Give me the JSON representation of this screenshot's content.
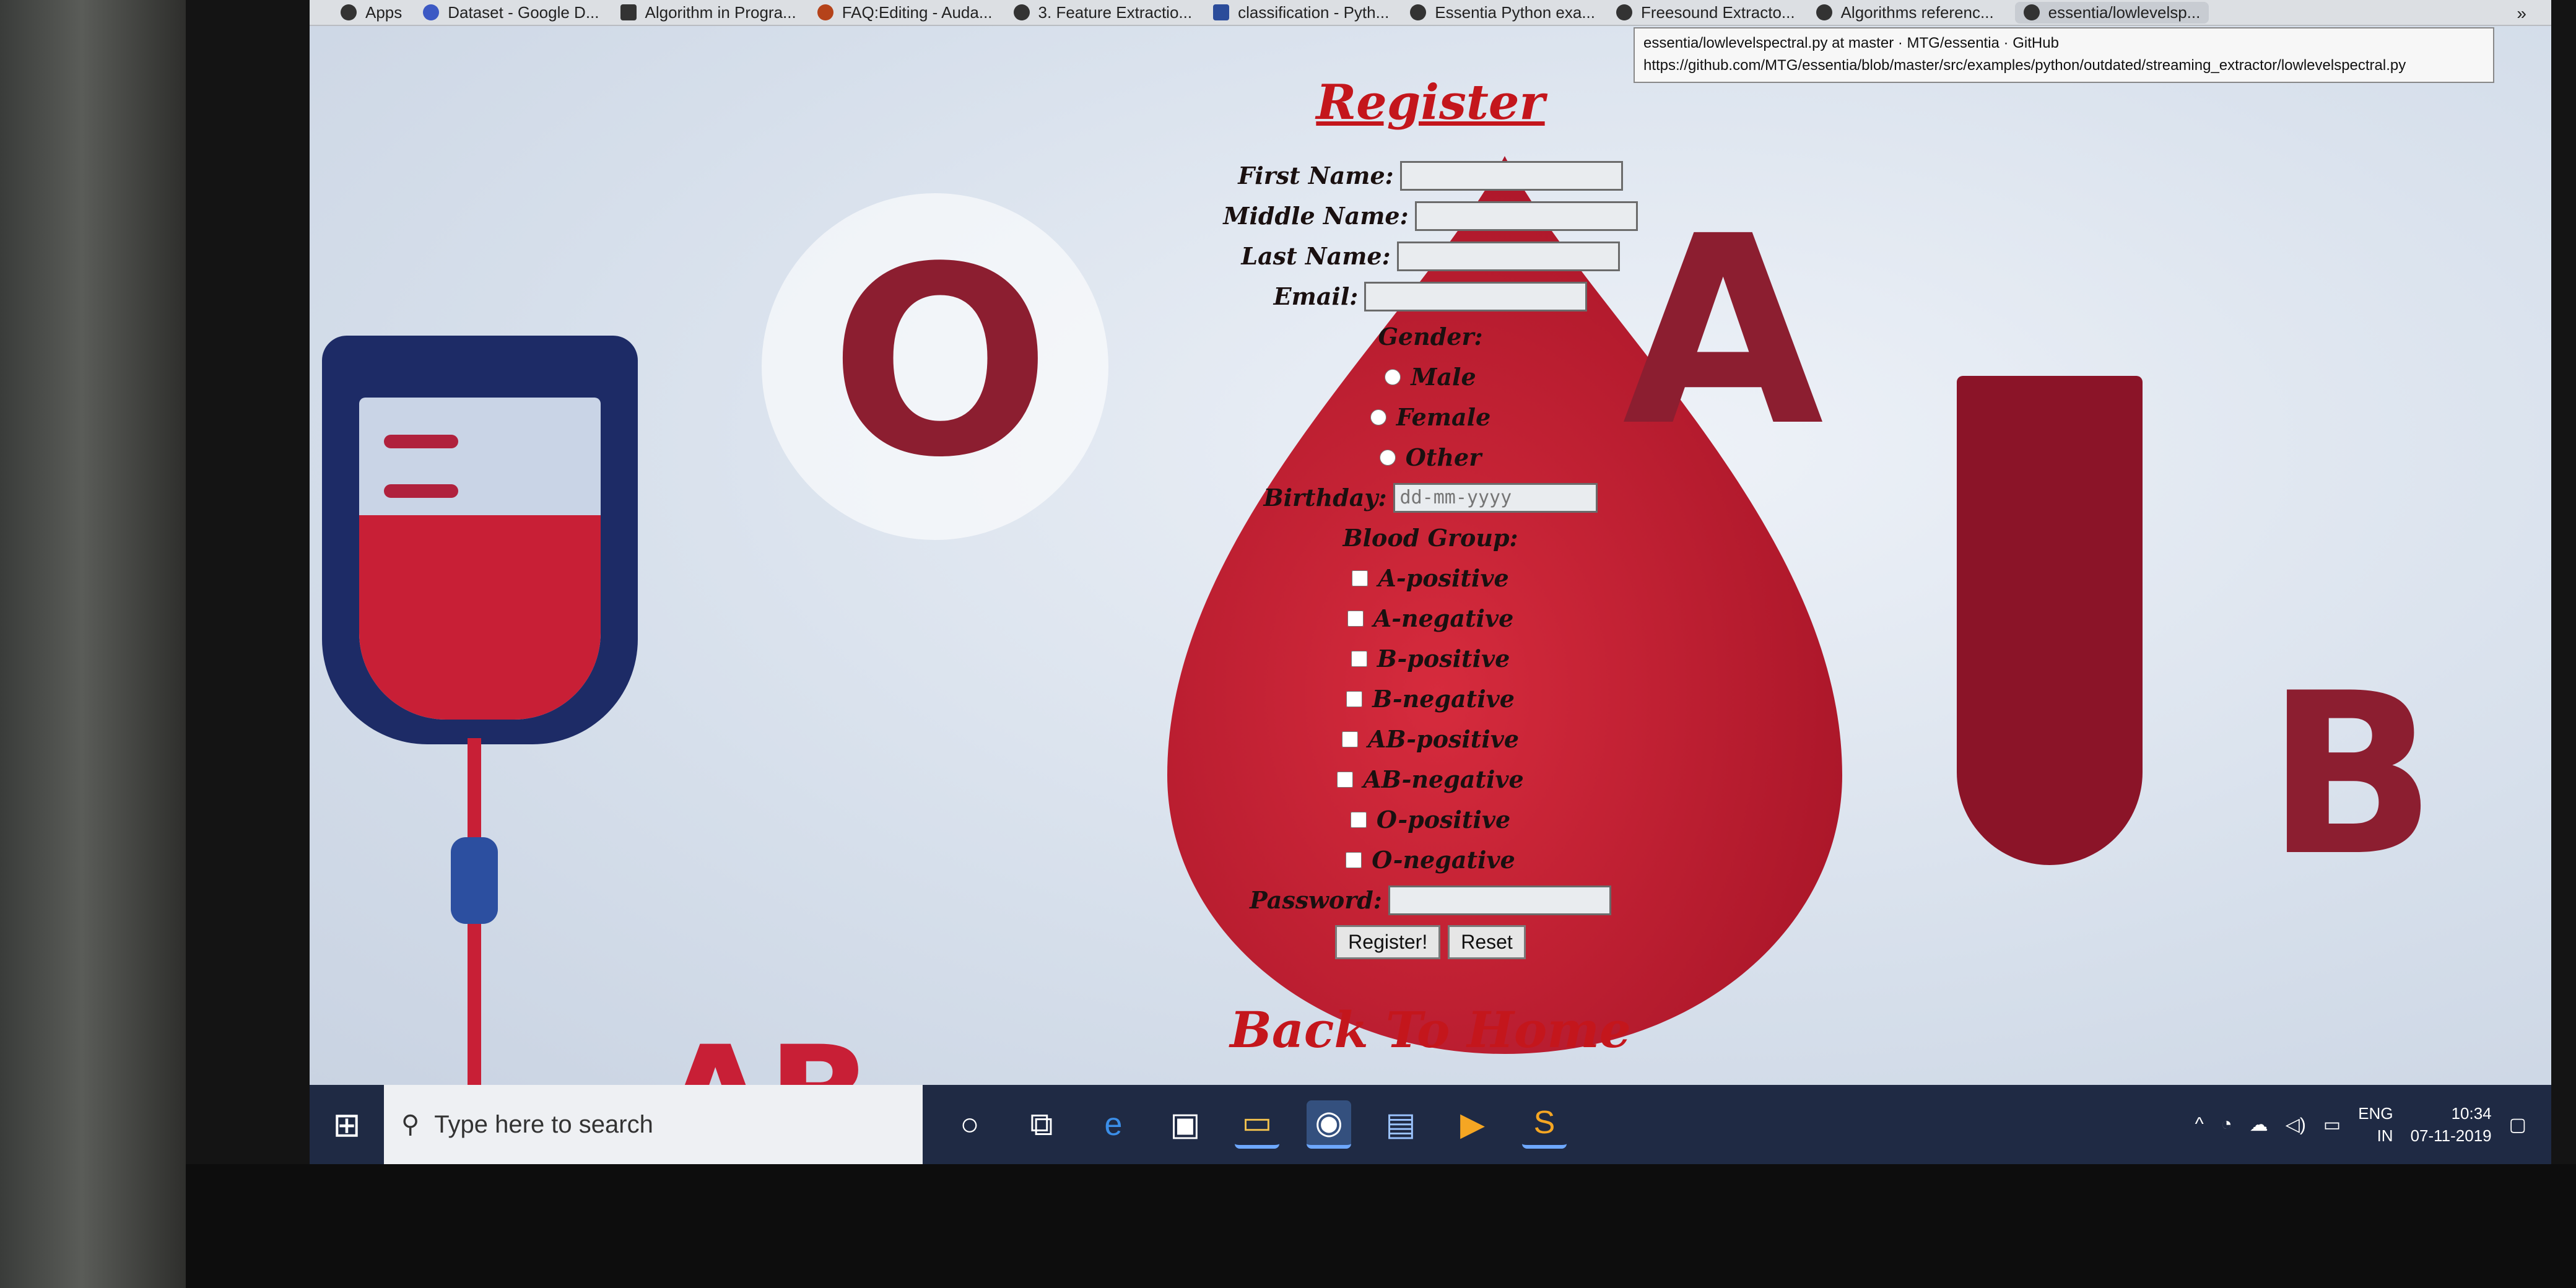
{
  "browser": {
    "tabs": [
      {
        "label": "Apps",
        "icon": "apps-icon"
      },
      {
        "label": "Dataset - Google D...",
        "icon": "google-drive-icon"
      },
      {
        "label": "Algorithm in Progra...",
        "icon": "bookmark-icon"
      },
      {
        "label": "FAQ:Editing - Auda...",
        "icon": "audacity-icon"
      },
      {
        "label": "3. Feature Extractio...",
        "icon": "github-icon"
      },
      {
        "label": "classification - Pyth...",
        "icon": "bookmark-icon"
      },
      {
        "label": "Essentia Python exa...",
        "icon": "essentia-icon"
      },
      {
        "label": "Freesound Extracto...",
        "icon": "essentia-icon"
      },
      {
        "label": "Algorithms referenc...",
        "icon": "essentia-icon"
      },
      {
        "label": "essentia/lowlevelsp...",
        "icon": "github-icon"
      }
    ],
    "more": "»",
    "tooltip": {
      "title": "essentia/lowlevelspectral.py at master · MTG/essentia · GitHub",
      "url": "https://github.com/MTG/essentia/blob/master/src/examples/python/outdated/streaming_extractor/lowlevelspectral.py"
    }
  },
  "background": {
    "letters": [
      "O",
      "A",
      "B",
      "AB"
    ]
  },
  "form": {
    "title": "Register",
    "first_name_label": "First Name:",
    "middle_name_label": "Middle Name:",
    "last_name_label": "Last Name:",
    "email_label": "Email:",
    "gender_label": "Gender:",
    "gender_options": [
      "Male",
      "Female",
      "Other"
    ],
    "birthday_label": "Birthday:",
    "birthday_placeholder": "dd-mm-yyyy",
    "blood_group_label": "Blood Group:",
    "blood_groups": [
      "A-positive",
      "A-negative",
      "B-positive",
      "B-negative",
      "AB-positive",
      "AB-negative",
      "O-positive",
      "O-negative"
    ],
    "password_label": "Password:",
    "register_button": "Register!",
    "reset_button": "Reset",
    "back_link": "Back To Home"
  },
  "taskbar": {
    "search_placeholder": "Type here to search",
    "apps": [
      "cortana-icon",
      "task-view-icon",
      "edge-icon",
      "store-icon",
      "file-explorer-icon",
      "chrome-icon",
      "app-icon",
      "media-player-icon",
      "sublime-text-icon"
    ],
    "tray_language": "ENG",
    "tray_region": "IN",
    "time": "10:34",
    "date": "07-11-2019"
  }
}
